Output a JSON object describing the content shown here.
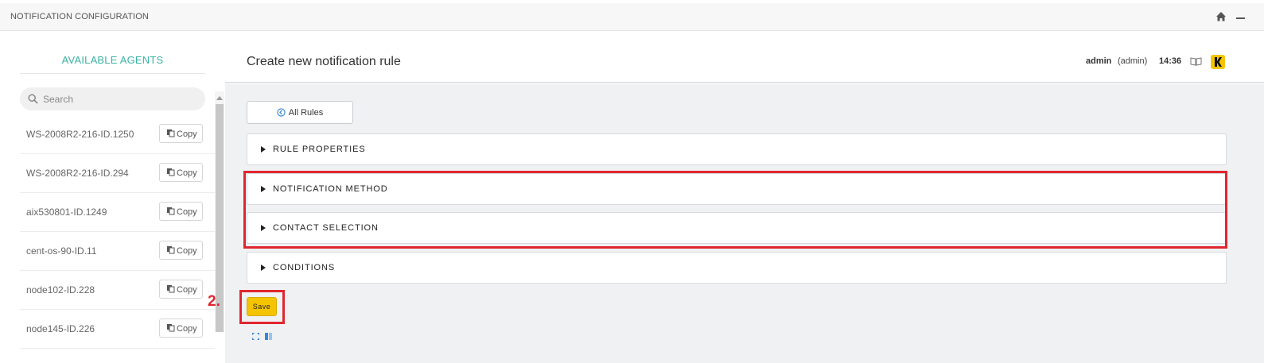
{
  "header": {
    "title": "NOTIFICATION CONFIGURATION",
    "home_icon": "home-icon",
    "minimize_icon": "minus-icon"
  },
  "sidebar": {
    "title": "AVAILABLE AGENTS",
    "search_placeholder": "Search",
    "copy_label": "Copy",
    "agents": [
      {
        "name": "WS-2008R2-216-ID.1250"
      },
      {
        "name": "WS-2008R2-216-ID.294"
      },
      {
        "name": "aix530801-ID.1249"
      },
      {
        "name": "cent-os-90-ID.11"
      },
      {
        "name": "node102-ID.228"
      },
      {
        "name": "node145-ID.226"
      }
    ]
  },
  "main": {
    "page_title": "Create new notification rule",
    "user": "admin",
    "user_role": "(admin)",
    "time": "14:36",
    "all_rules_label": "All Rules",
    "sections": [
      {
        "label": "RULE PROPERTIES"
      },
      {
        "label": "NOTIFICATION METHOD"
      },
      {
        "label": "CONTACT SELECTION"
      },
      {
        "label": "CONDITIONS"
      }
    ],
    "save_label": "Save",
    "step_annotation": "2."
  },
  "colors": {
    "accent_teal": "#3bb3a3",
    "save_yellow": "#f5c400",
    "highlight_red": "#e0262f"
  }
}
